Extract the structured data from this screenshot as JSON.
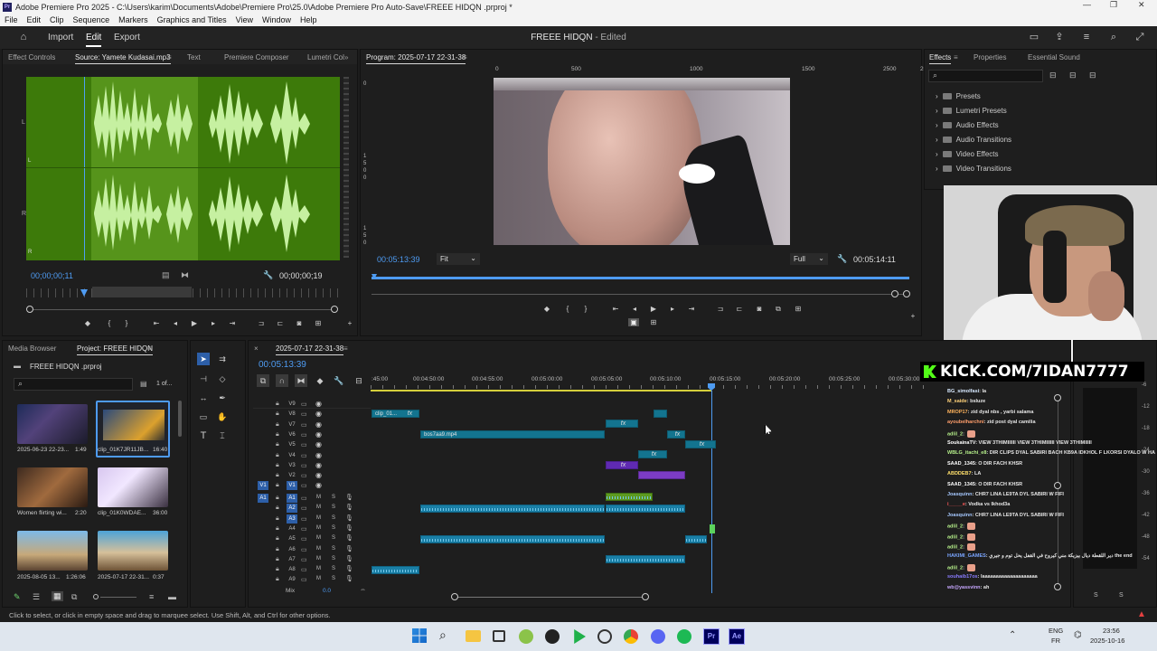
{
  "window": {
    "title": "Adobe Premiere Pro 2025 - C:\\Users\\karim\\Documents\\Adobe\\Premiere Pro\\25.0\\Adobe Premiere Pro Auto-Save\\FREEE HIDQN .prproj *",
    "app_icon": "Pr"
  },
  "menu": [
    "File",
    "Edit",
    "Clip",
    "Sequence",
    "Markers",
    "Graphics and Titles",
    "View",
    "Window",
    "Help"
  ],
  "header": {
    "nav": [
      "Import",
      "Edit",
      "Export"
    ],
    "active_nav": "Edit",
    "project_title": "FREEE HIDQN",
    "project_status": "- Edited"
  },
  "source_panel": {
    "tabs": [
      "Effect Controls",
      "Source: Yamete Kudasai.mp3",
      "Text",
      "Premiere Composer",
      "Lumetri Col"
    ],
    "active_tab": "Source: Yamete Kudasai.mp3",
    "channel_labels": [
      "L",
      "L",
      "R",
      "R"
    ],
    "timecode_in": "00;00;00;11",
    "timecode_duration": "00;00;00;19"
  },
  "program_panel": {
    "title": "Program: 2025-07-17 22-31-38",
    "ruler": [
      "0",
      "500",
      "1000",
      "1500",
      "2000",
      "2500"
    ],
    "vruler": [
      "0",
      "1",
      "5",
      "0",
      "0",
      "1",
      "5",
      "0"
    ],
    "timecode": "00:05:13:39",
    "fit": "Fit",
    "quality": "Full",
    "duration": "00:05:14:11"
  },
  "effects_panel": {
    "tabs": [
      "Effects",
      "Properties",
      "Essential Sound"
    ],
    "active_tab": "Effects",
    "items": [
      "Presets",
      "Lumetri Presets",
      "Audio Effects",
      "Audio Transitions",
      "Video Effects",
      "Video Transitions"
    ]
  },
  "project_panel": {
    "tabs": [
      "Media Browser",
      "Project: FREEE HIDQN"
    ],
    "active_tab": "Project: FREEE HIDQN",
    "file": "FREEE HIDQN .prproj",
    "count": "1 of...",
    "items": [
      {
        "name": "2025-06-23 22-23...",
        "dur": "1:49"
      },
      {
        "name": "clip_01K7JR11JB...",
        "dur": "16:40"
      },
      {
        "name": "Women flirting wi...",
        "dur": "2:20"
      },
      {
        "name": "clip_01K0WDAE...",
        "dur": "36:00"
      },
      {
        "name": "2025-08-05 13...",
        "dur": "1:26:06"
      },
      {
        "name": "2025-07-17 22-31...",
        "dur": "0:37"
      }
    ]
  },
  "timeline": {
    "sequence_name": "2025-07-17 22-31-38",
    "timecode": "00:05:13:39",
    "ruler": [
      ":45:00",
      "00:04:50:00",
      "00:04:55:00",
      "00:05:00:00",
      "00:05:05:00",
      "00:05:10:00",
      "00:05:15:00",
      "00:05:20:00",
      "00:05:25:00",
      "00:05:30:00"
    ],
    "video_tracks": [
      "V9",
      "V8",
      "V7",
      "V6",
      "V5",
      "V4",
      "V3",
      "V2",
      "V1"
    ],
    "audio_tracks": [
      "A1",
      "A2",
      "A3",
      "A4",
      "A5",
      "A6",
      "A7",
      "A8",
      "A9"
    ],
    "mix_label": "Mix",
    "mix_value": "0.0",
    "clip_labels": [
      "clip_01...",
      "bos7aa9.mp4"
    ],
    "fx": "fx",
    "mute": "M",
    "solo": "S",
    "source_patch_v": "V1",
    "source_patch_a": "A1"
  },
  "meters": {
    "scale": [
      "-6",
      "-12",
      "-18",
      "-24",
      "-30",
      "-36",
      "-42",
      "-48",
      "-54"
    ],
    "solo": [
      "S",
      "S"
    ]
  },
  "overlay": {
    "banner": "KICK.COM/7IDAN7777"
  },
  "chat": [
    {
      "user": "BG_simolfasi",
      "msg": ": la",
      "color": "#d7e9ff"
    },
    {
      "user": "M_saide",
      "msg": ": bsluze",
      "color": "#ffd27a"
    },
    {
      "user": "MROP17",
      "msg": ": zid dyal nbs , yarbi salama",
      "color": "#ffb35c"
    },
    {
      "user": "ayoubelharchni",
      "msg": ": zid post dyal camilia",
      "color": "#ff9e6b"
    },
    {
      "user": "adlil_2",
      "msg": ":",
      "color": "#b6f08a"
    },
    {
      "user": "SoukainaTV",
      "msg": ": VIEW 3THIMIIIIII VIEW 3THIMIIIIII VIEW 3THIMIIIII",
      "color": "#ffffff"
    },
    {
      "user": "WBLG_itachi_e8",
      "msg": ": DIR CLIPS DYAL SABIRI BACH KB9A IDKHOL F LKORSI DYALO W HA",
      "color": "#b6f08a"
    },
    {
      "user": "SAAD_1345",
      "msg": ": O DIR FACH KHSR",
      "color": "#ffffff"
    },
    {
      "user": "ABDDEB7",
      "msg": ": LA",
      "color": "#ffdf6b"
    },
    {
      "user": "SAAD_1345",
      "msg": ": O DIR FACH KHSR",
      "color": "#ffffff"
    },
    {
      "user": "Joasquinn",
      "msg": ": CHR7 LINA LE9TA DYL SABIRI W FIFI",
      "color": "#a6c8ff"
    },
    {
      "user": "i_____e",
      "msg": ": Vodka vs Ikhod3a",
      "color": "#ff5a5a"
    },
    {
      "user": "Joasquinn",
      "msg": ": CHR7 LINA LE9TA DYL SABIRI W FIFI",
      "color": "#a6c8ff"
    },
    {
      "user": "adlil_2",
      "msg": ":",
      "color": "#b6f08a"
    },
    {
      "user": "adlil_2",
      "msg": ":",
      "color": "#b6f08a"
    },
    {
      "user": "adlil_2",
      "msg": ":",
      "color": "#b6f08a"
    },
    {
      "user": "HAKIMI_GAMES",
      "msg": ": دير اللقطة ديال بيزيكة مني كيروح في القفل يحل توم و جيري the end",
      "color": "#7aa5ff"
    },
    {
      "user": "adlil_2",
      "msg": ":",
      "color": "#b6f08a"
    },
    {
      "user": "souhaib17os",
      "msg": ": laaaaaaaaaaaaaaaaaaaa",
      "color": "#8a7cff"
    },
    {
      "user": "wb@yassvinn",
      "msg": ": ah",
      "color": "#c7a7ff"
    }
  ],
  "status_bar": "Click to select, or click in empty space and drag to marquee select. Use Shift, Alt, and Ctrl for other options.",
  "taskbar": {
    "lang": "ENG",
    "layout": "FR",
    "time": "23:56",
    "date": "2025-10-16"
  }
}
